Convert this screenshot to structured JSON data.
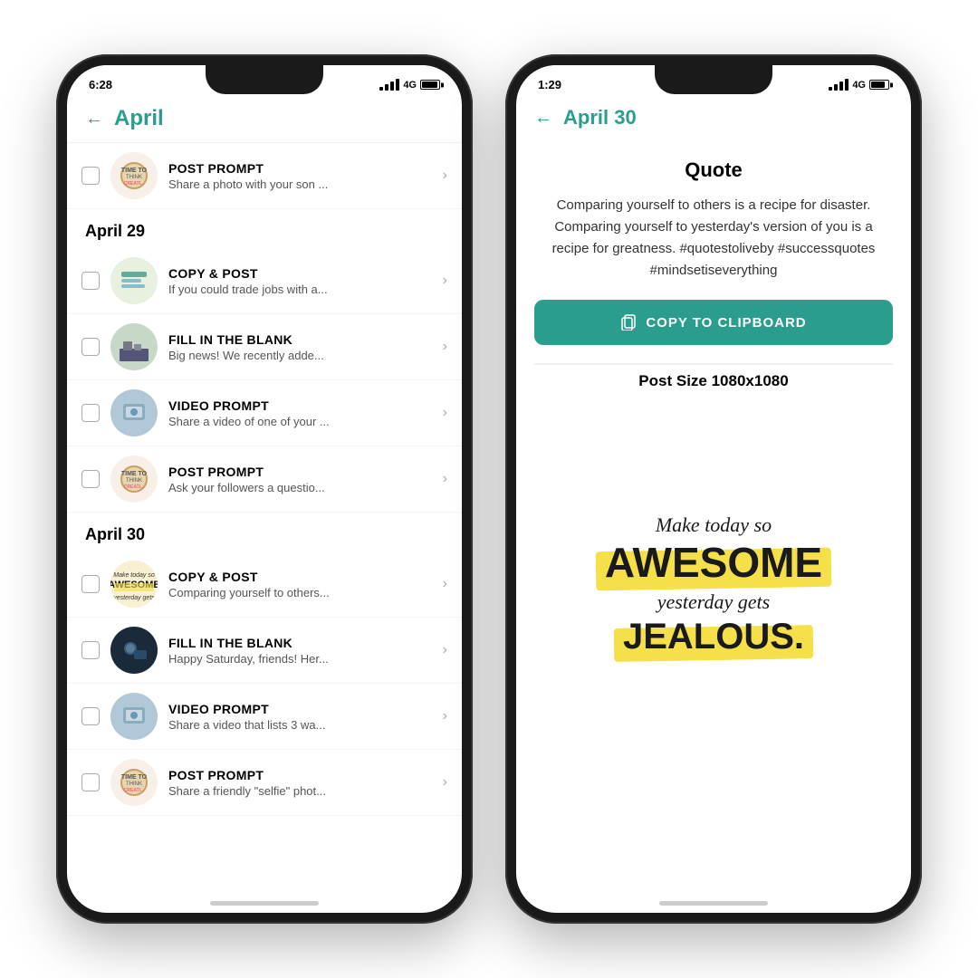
{
  "phone1": {
    "status": {
      "time": "6:28",
      "icons": "oo ....",
      "signal": "4G",
      "battery": 91
    },
    "header": {
      "back": "←",
      "title": "April"
    },
    "sections": [
      {
        "items": [
          {
            "type": "POST PROMPT",
            "subtitle": "Share a photo with your son ...",
            "thumb": "clock"
          }
        ]
      },
      {
        "label": "April 29",
        "items": [
          {
            "type": "COPY & POST",
            "subtitle": "If you could trade jobs with a...",
            "thumb": "chat"
          },
          {
            "type": "FILL IN THE BLANK",
            "subtitle": "Big news! We recently adde...",
            "thumb": "city"
          },
          {
            "type": "VIDEO PROMPT",
            "subtitle": "Share a video of one of your ...",
            "thumb": "phone-img"
          },
          {
            "type": "POST PROMPT",
            "subtitle": "Ask your followers a questio...",
            "thumb": "clock"
          }
        ]
      },
      {
        "label": "April 30",
        "items": [
          {
            "type": "COPY & POST",
            "subtitle": "Comparing yourself to others...",
            "thumb": "awesome-thumb"
          },
          {
            "type": "FILL IN THE BLANK",
            "subtitle": "Happy Saturday, friends! Her...",
            "thumb": "city"
          },
          {
            "type": "VIDEO PROMPT",
            "subtitle": "Share a video that lists 3 wa...",
            "thumb": "phone-img"
          },
          {
            "type": "POST PROMPT",
            "subtitle": "Share a friendly \"selfie\" phot...",
            "thumb": "clock"
          }
        ]
      }
    ]
  },
  "phone2": {
    "status": {
      "time": "1:29",
      "icons": "...",
      "signal": "4G",
      "battery": 79
    },
    "header": {
      "back": "←",
      "title": "April 30"
    },
    "section_label": "Quote",
    "quote_body": "Comparing yourself to others is a recipe for disaster. Comparing yourself to yesterday's version of you is a recipe for greatness. #quotestoliveby #successquotes #mindsetiseverything",
    "copy_button": "COPY TO CLIPBOARD",
    "post_size": "Post Size 1080x1080",
    "card": {
      "line1": "Make today so",
      "line2": "AWESOME",
      "line3": "yesterday gets",
      "line4": "JEALOUS."
    }
  }
}
